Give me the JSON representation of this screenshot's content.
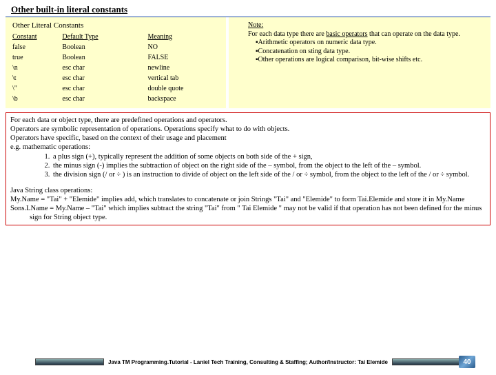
{
  "header": "Other  built-in literal constants",
  "literal": {
    "title": "Other Literal Constants",
    "headers": {
      "c1": "Constant",
      "c2": "Default Type",
      "c3": "Meaning"
    },
    "rows": [
      {
        "c1": "false",
        "c2": "Boolean",
        "c3": "NO"
      },
      {
        "c1": "true",
        "c2": "Boolean",
        "c3": "FALSE"
      },
      {
        "c1": "\\n",
        "c2": "esc char",
        "c3": "newline"
      },
      {
        "c1": "\\t",
        "c2": "esc char",
        "c3": "vertical tab"
      },
      {
        "c1": "\\\"",
        "c2": "esc char",
        "c3": "double quote"
      },
      {
        "c1": "\\b",
        "c2": "esc char",
        "c3": "backspace"
      }
    ]
  },
  "note": {
    "title": "Note:",
    "line1": "For each data type there are ",
    "line1_u": "basic operators",
    "line1b": " that can operate on the data type.",
    "b1": "▪Arithmetic operators on numeric data type.",
    "b2": "▪Concatenation on sting data type.",
    "b3": "▪Other operations are logical comparison, bit-wise shifts etc."
  },
  "desc": {
    "p1": "For each data or object type, there are predefined operations and operators.",
    "p2": "Operators are symbolic representation of operations. Operations specify what to do with objects.",
    "p3": "Operators have specific, based on the context of their usage and placement",
    "p4": "e.g. mathematic operations:",
    "li1": "a plus sign (+), typically represent the addition of some objects on both side of the + sign,",
    "li2": "the minus sign (-) implies the subtraction of object on the right side of the – symbol, from the object to the left of the – symbol.",
    "li3": "the division sign (/ or ÷ ) is an instruction to divide of object on the left side of the / or ÷ symbol, from the object to the left of the / or ÷ symbol.",
    "j_title": "Java String class operations:",
    "j1a": "My.Name = \"Tai\" + \"Elemide\"  implies add, which translates to concatenate or join Strings \"Tai\" and \"Elemide\" to form Tai.Elemide and store it in My.Name",
    "j2": "Sons.LName = My.Name – \"Tai\"   which implies subtract the string \"Tai\" from \" Tai Elemide \" may not be valid if that operation has not been defined for the minus sign for String object type."
  },
  "footer": "Java TM Programming.Tutorial -  Laniel Tech Training, Consulting & Staffing; Author/Instructor: Tai Elemide",
  "slide_num": "40"
}
